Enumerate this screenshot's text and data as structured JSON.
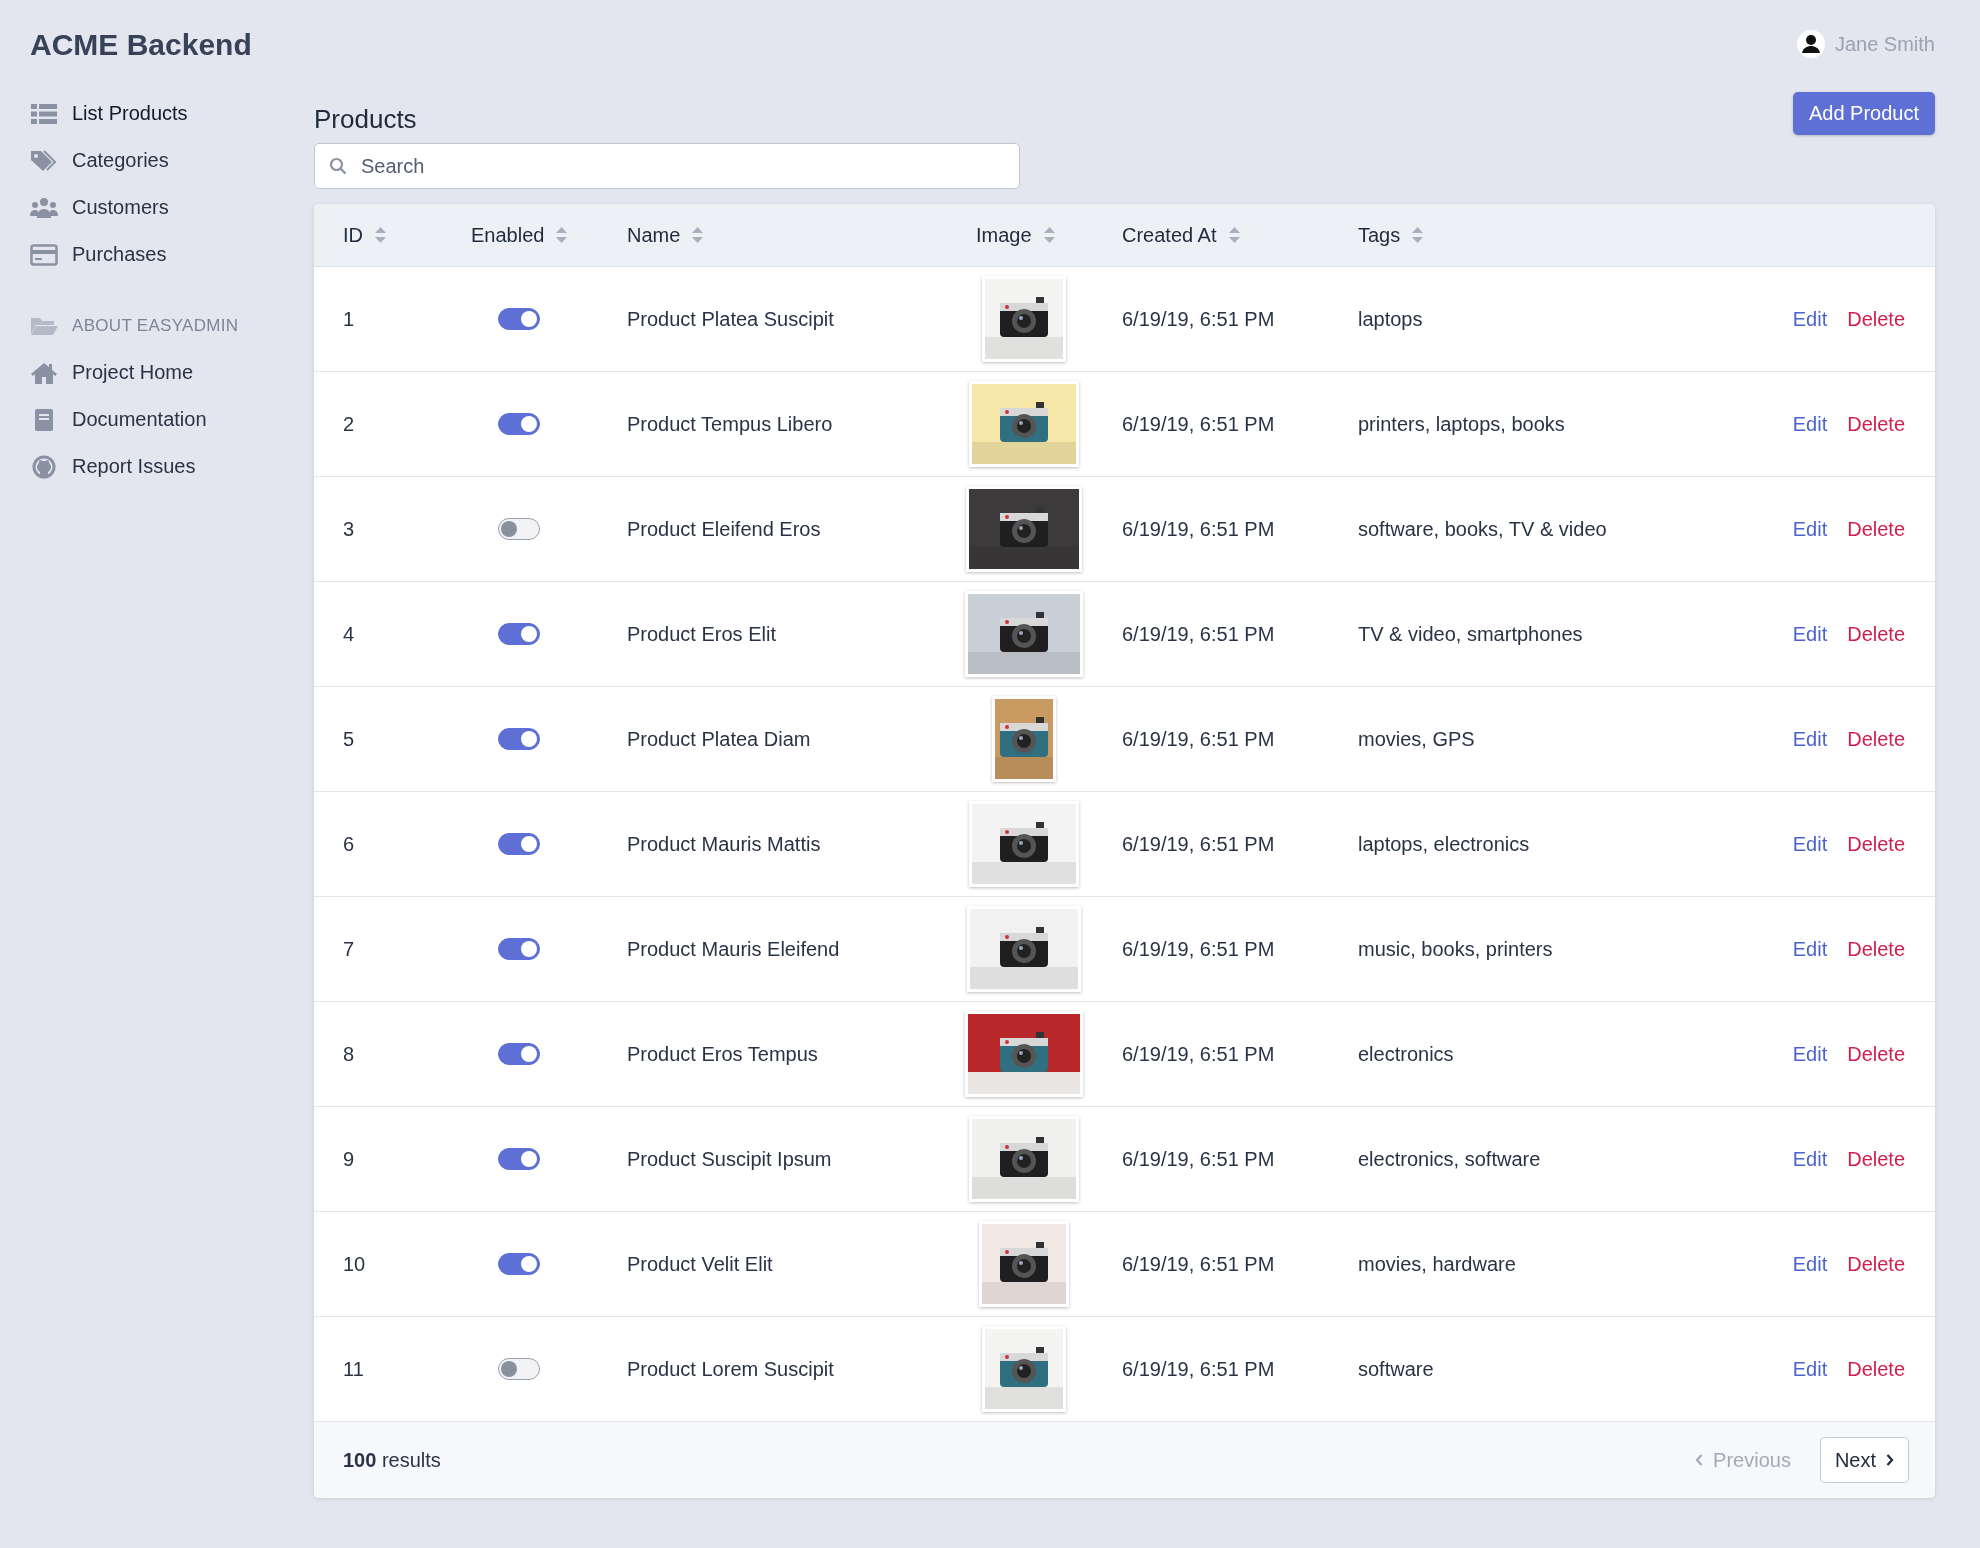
{
  "brand": "ACME Backend",
  "user": {
    "name": "Jane Smith"
  },
  "sidebar": {
    "items": [
      {
        "label": "List Products",
        "kind": "list",
        "selected": true
      },
      {
        "label": "Categories",
        "kind": "tags",
        "selected": false
      },
      {
        "label": "Customers",
        "kind": "users",
        "selected": false
      },
      {
        "label": "Purchases",
        "kind": "card",
        "selected": false
      }
    ],
    "section": {
      "label": "ABOUT EASYADMIN",
      "items": [
        {
          "label": "Project Home",
          "kind": "home"
        },
        {
          "label": "Documentation",
          "kind": "book"
        },
        {
          "label": "Report Issues",
          "kind": "github"
        }
      ]
    }
  },
  "page": {
    "title": "Products",
    "add_button": "Add Product",
    "search": {
      "placeholder": "Search"
    }
  },
  "table": {
    "columns": [
      "ID",
      "Enabled",
      "Name",
      "Image",
      "Created At",
      "Tags"
    ],
    "rows": [
      {
        "id": "1",
        "enabled": true,
        "name": "Product Platea Suscipit",
        "created": "6/19/19, 6:51 PM",
        "tags": "laptops",
        "edit": "Edit",
        "delete": "Delete"
      },
      {
        "id": "2",
        "enabled": true,
        "name": "Product Tempus Libero",
        "created": "6/19/19, 6:51 PM",
        "tags": "printers, laptops, books",
        "edit": "Edit",
        "delete": "Delete"
      },
      {
        "id": "3",
        "enabled": false,
        "name": "Product Eleifend Eros",
        "created": "6/19/19, 6:51 PM",
        "tags": "software, books, TV & video",
        "edit": "Edit",
        "delete": "Delete"
      },
      {
        "id": "4",
        "enabled": true,
        "name": "Product Eros Elit",
        "created": "6/19/19, 6:51 PM",
        "tags": "TV & video, smartphones",
        "edit": "Edit",
        "delete": "Delete"
      },
      {
        "id": "5",
        "enabled": true,
        "name": "Product Platea Diam",
        "created": "6/19/19, 6:51 PM",
        "tags": "movies, GPS",
        "edit": "Edit",
        "delete": "Delete"
      },
      {
        "id": "6",
        "enabled": true,
        "name": "Product Mauris Mattis",
        "created": "6/19/19, 6:51 PM",
        "tags": "laptops, electronics",
        "edit": "Edit",
        "delete": "Delete"
      },
      {
        "id": "7",
        "enabled": true,
        "name": "Product Mauris Eleifend",
        "created": "6/19/19, 6:51 PM",
        "tags": "music, books, printers",
        "edit": "Edit",
        "delete": "Delete"
      },
      {
        "id": "8",
        "enabled": true,
        "name": "Product Eros Tempus",
        "created": "6/19/19, 6:51 PM",
        "tags": "electronics",
        "edit": "Edit",
        "delete": "Delete"
      },
      {
        "id": "9",
        "enabled": true,
        "name": "Product Suscipit Ipsum",
        "created": "6/19/19, 6:51 PM",
        "tags": "electronics, software",
        "edit": "Edit",
        "delete": "Delete"
      },
      {
        "id": "10",
        "enabled": true,
        "name": "Product Velit Elit",
        "created": "6/19/19, 6:51 PM",
        "tags": "movies, hardware",
        "edit": "Edit",
        "delete": "Delete"
      },
      {
        "id": "11",
        "enabled": false,
        "name": "Product Lorem Suscipit",
        "created": "6/19/19, 6:51 PM",
        "tags": "software",
        "edit": "Edit",
        "delete": "Delete"
      }
    ]
  },
  "footer": {
    "results": "**100** results",
    "previous": {
      "label": "Previous",
      "disabled": true
    },
    "next": {
      "label": "Next",
      "disabled": false
    }
  }
}
